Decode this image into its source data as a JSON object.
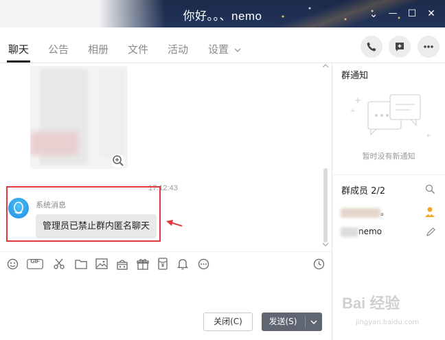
{
  "window": {
    "title": "你好。。、nemo",
    "controls": {
      "dropdown": "⌄",
      "minimize": "—",
      "maximize": "☐",
      "close": "✕"
    }
  },
  "tabs": [
    {
      "label": "聊天",
      "active": true
    },
    {
      "label": "公告"
    },
    {
      "label": "相册"
    },
    {
      "label": "文件"
    },
    {
      "label": "活动"
    },
    {
      "label": "设置"
    }
  ],
  "header_actions": [
    "phone-icon",
    "add-message-icon",
    "more-icon"
  ],
  "chat": {
    "timestamp": "17:12:43",
    "sender": "系统消息",
    "message": "管理员已禁止群内匿名聊天"
  },
  "toolbar_icons": [
    "emoji-icon",
    "gif-icon",
    "scissors-icon",
    "folder-icon",
    "image-icon",
    "gift-box-icon",
    "gift-icon",
    "red-packet-icon",
    "bell-icon",
    "more-icon",
    "history-clock-icon"
  ],
  "toolbar_gif_label": "GIF",
  "buttons": {
    "close": "关闭(C)",
    "send": "发送(S)"
  },
  "right_panel": {
    "notice_title": "群通知",
    "notice_empty": "暂时没有新通知",
    "members_title": "群成员 2/2",
    "members": [
      {
        "name": "。"
      },
      {
        "name": "nemo"
      }
    ]
  },
  "watermark": {
    "main": "Bai 经验",
    "sub": "jingyan.baidu.com"
  },
  "colors": {
    "titlebar": "#1b2a4a",
    "highlight_box": "#e0393e",
    "send_button": "#5f6672"
  }
}
